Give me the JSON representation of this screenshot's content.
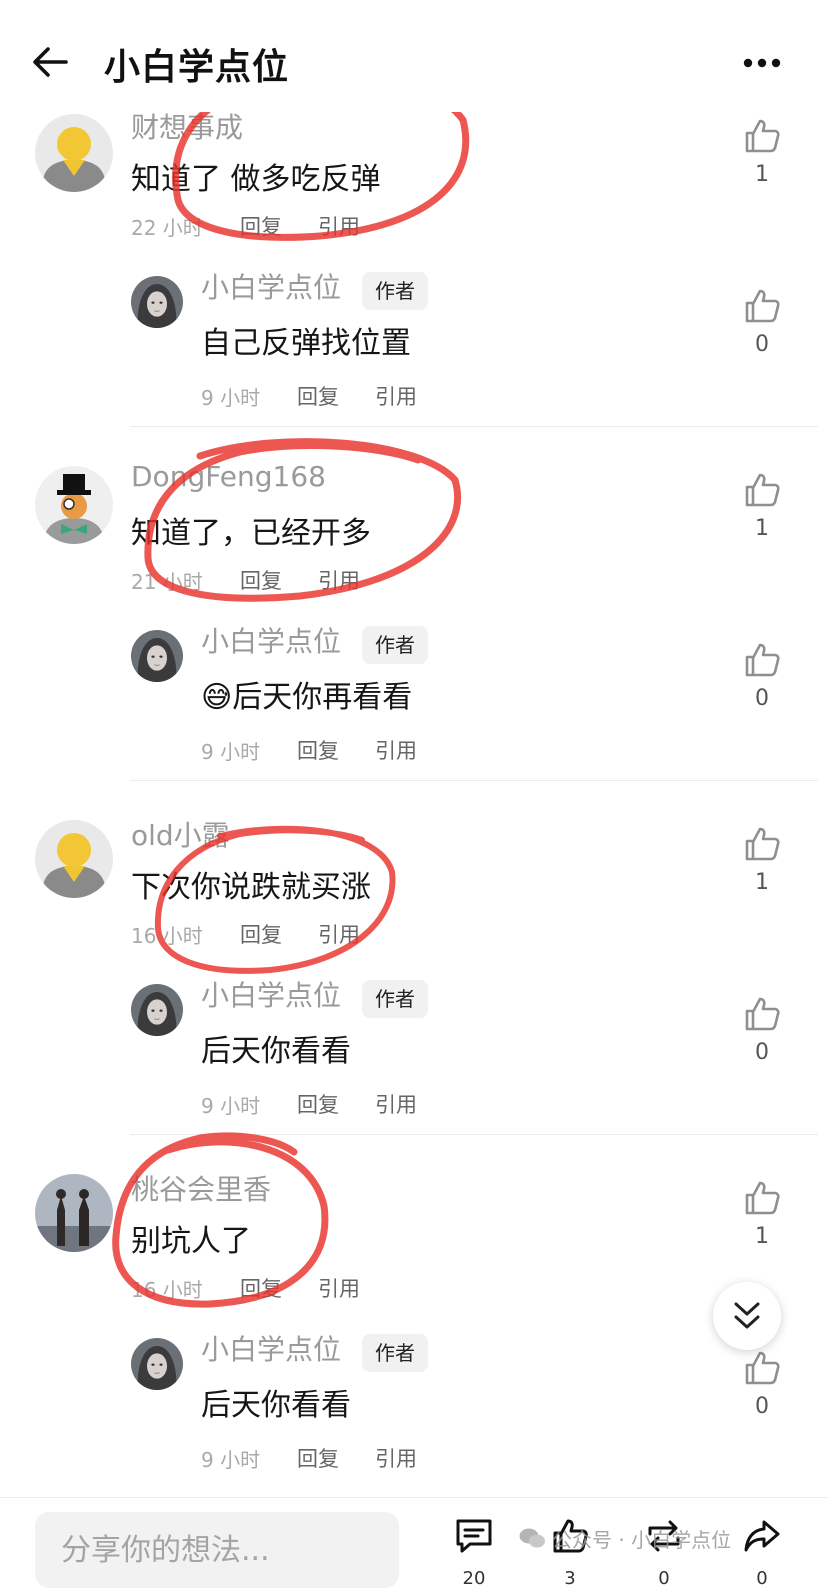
{
  "header": {
    "title": "小白学点位",
    "back_icon": "arrow-left-icon",
    "more_icon": "more-dots-icon"
  },
  "comments": [
    {
      "user": "财想事成",
      "text": "知道了 做多吃反弹",
      "time": "22 小时",
      "reply_label": "回复",
      "quote_label": "引用",
      "likes": "1",
      "avatar": "yellow-person",
      "reply": {
        "user": "小白学点位",
        "tag": "作者",
        "emoji": "",
        "text": "自己反弹找位置",
        "time": "9 小时",
        "reply_label": "回复",
        "quote_label": "引用",
        "likes": "0"
      }
    },
    {
      "user": "DongFeng168",
      "text": "知道了，已经开多",
      "time": "21 小时",
      "reply_label": "回复",
      "quote_label": "引用",
      "likes": "1",
      "avatar": "top-hat-person",
      "reply": {
        "user": "小白学点位",
        "tag": "作者",
        "emoji": "😅",
        "text": "后天你再看看",
        "time": "9 小时",
        "reply_label": "回复",
        "quote_label": "引用",
        "likes": "0"
      }
    },
    {
      "user": "old小露",
      "text": "下次你说跌就买涨",
      "time": "16 小时",
      "reply_label": "回复",
      "quote_label": "引用",
      "likes": "1",
      "avatar": "yellow-person",
      "reply": {
        "user": "小白学点位",
        "tag": "作者",
        "emoji": "",
        "text": "后天你看看",
        "time": "9 小时",
        "reply_label": "回复",
        "quote_label": "引用",
        "likes": "0"
      }
    },
    {
      "user": "桃谷会里香",
      "text": "别坑人了",
      "time": "16 小时",
      "reply_label": "回复",
      "quote_label": "引用",
      "likes": "1",
      "avatar": "statues-photo",
      "reply": {
        "user": "小白学点位",
        "tag": "作者",
        "emoji": "",
        "text": "后天你看看",
        "time": "9 小时",
        "reply_label": "回复",
        "quote_label": "引用",
        "likes": "0"
      }
    }
  ],
  "bottom_bar": {
    "input_placeholder": "分享你的想法...",
    "comment_count": "20",
    "like_count": "3",
    "repost_count": "0",
    "share_count": "0"
  },
  "watermark": "公众号 · 小白学点位",
  "colors": {
    "annotation_red": "#e8322c",
    "meta_gray": "#a9a9a9",
    "name_gray": "#9a9a9a"
  }
}
